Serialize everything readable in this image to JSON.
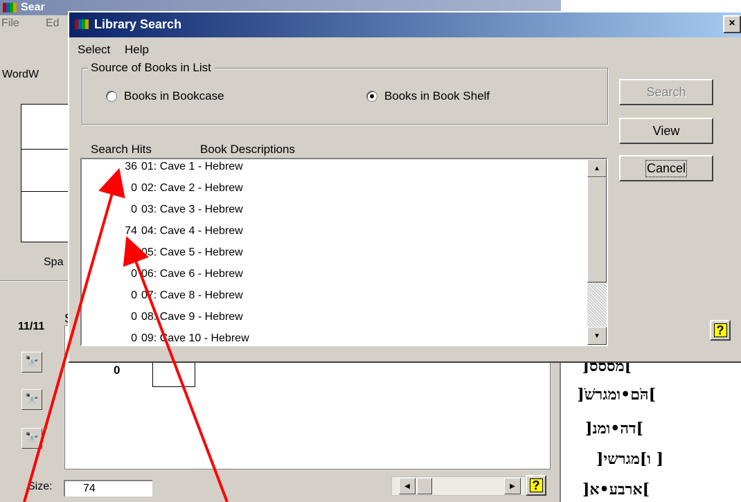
{
  "background_window": {
    "title": "Sear",
    "menu": [
      "File",
      "Ed"
    ],
    "label_top": "WordW",
    "label_spa": "Spa",
    "counter": "11/11",
    "counter_suffix": "S",
    "count_value": "0",
    "size_label": "Size:",
    "size_value": "74",
    "help_glyph": "?"
  },
  "dialog": {
    "title": "Library Search",
    "close_glyph": "×",
    "menu": [
      "Select",
      "Help"
    ],
    "source_group": {
      "legend": "Source of Books in List",
      "options": [
        {
          "label": "Books in Bookcase",
          "selected": false
        },
        {
          "label": "Books in Book Shelf",
          "selected": true
        }
      ]
    },
    "columns": [
      "Search Hits",
      "Book Descriptions"
    ],
    "books": [
      {
        "hits": "36",
        "desc": "01: Cave 1 - Hebrew"
      },
      {
        "hits": "0",
        "desc": "02: Cave 2 - Hebrew"
      },
      {
        "hits": "0",
        "desc": "03: Cave 3 - Hebrew"
      },
      {
        "hits": "74",
        "desc": "04: Cave 4 - Hebrew"
      },
      {
        "hits": "0",
        "desc": "05: Cave 5 - Hebrew"
      },
      {
        "hits": "0",
        "desc": "06: Cave 6 - Hebrew"
      },
      {
        "hits": "0",
        "desc": "07: Cave 8 - Hebrew"
      },
      {
        "hits": "0",
        "desc": "08: Cave 9 - Hebrew"
      },
      {
        "hits": "0",
        "desc": "09: Cave 10 - Hebrew"
      }
    ],
    "buttons": {
      "search": "Search",
      "view": "View",
      "cancel": "Cancel"
    },
    "help_glyph": "?"
  },
  "hebrew_lines": [
    "]מססס[",
    "]הֹּם•ומגרשֹׁ[",
    "]דה•ומנ[",
    "[ ו]מגרשי[",
    "]ארבע•א["
  ],
  "colors": {
    "title_active": "#0a246a",
    "window_bg": "#d4d0c8",
    "annotation": "#ff0000"
  },
  "icons": [
    "app-icon",
    "binoculars-icon",
    "close-icon",
    "help-icon",
    "scroll-up-arrow-icon",
    "scroll-down-arrow-icon"
  ]
}
